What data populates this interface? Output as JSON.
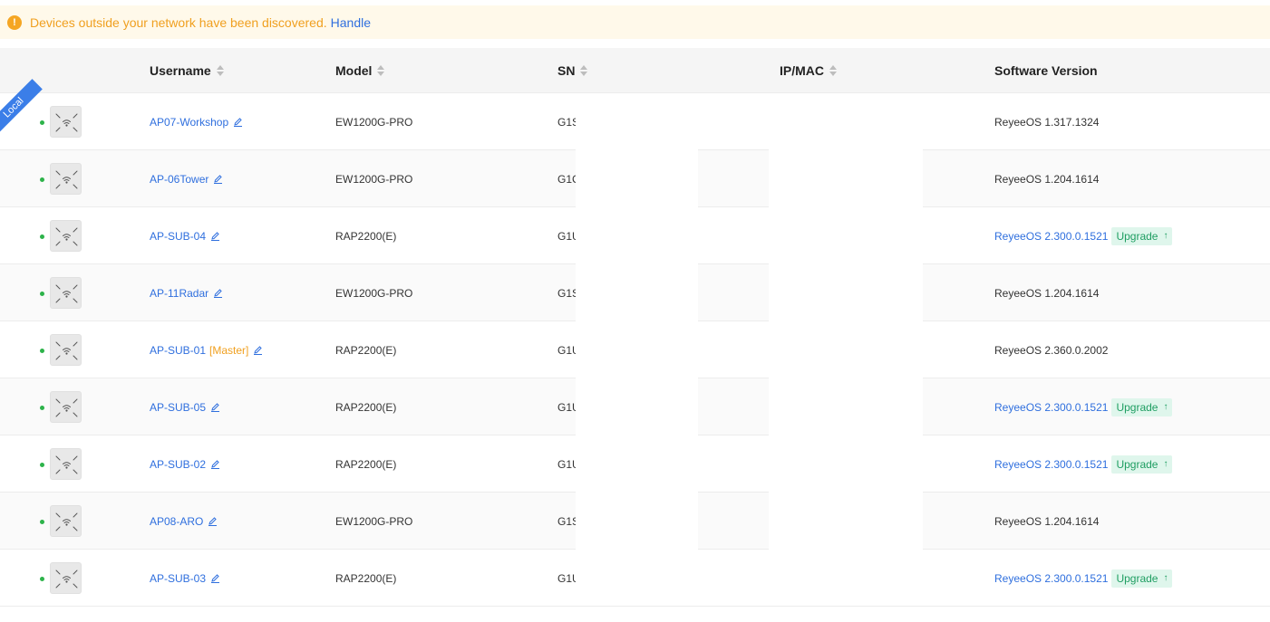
{
  "alert": {
    "icon": "warning-icon",
    "message": "Devices outside your network have been discovered.",
    "link_label": "Handle"
  },
  "columns": {
    "username": "Username",
    "model": "Model",
    "sn": "SN",
    "ipmac": "IP/MAC",
    "version": "Software Version"
  },
  "local_badge": "Local",
  "upgrade_label": "Upgrade",
  "rows": [
    {
      "username": "AP07-Workshop",
      "master": "",
      "model": "EW1200G-PRO",
      "sn": "G1S",
      "version": "ReyeeOS 1.317.1324",
      "upgradable": false
    },
    {
      "username": "AP-06Tower",
      "master": "",
      "model": "EW1200G-PRO",
      "sn": "G1C",
      "version": "ReyeeOS 1.204.1614",
      "upgradable": false
    },
    {
      "username": "AP-SUB-04",
      "master": "",
      "model": "RAP2200(E)",
      "sn": "G1U",
      "version": "ReyeeOS 2.300.0.1521",
      "upgradable": true
    },
    {
      "username": "AP-11Radar",
      "master": "",
      "model": "EW1200G-PRO",
      "sn": "G1S",
      "version": "ReyeeOS 1.204.1614",
      "upgradable": false
    },
    {
      "username": "AP-SUB-01",
      "master": "[Master]",
      "model": "RAP2200(E)",
      "sn": "G1U",
      "version": "ReyeeOS 2.360.0.2002",
      "upgradable": false
    },
    {
      "username": "AP-SUB-05",
      "master": "",
      "model": "RAP2200(E)",
      "sn": "G1U",
      "version": "ReyeeOS 2.300.0.1521",
      "upgradable": true
    },
    {
      "username": "AP-SUB-02",
      "master": "",
      "model": "RAP2200(E)",
      "sn": "G1U",
      "version": "ReyeeOS 2.300.0.1521",
      "upgradable": true
    },
    {
      "username": "AP08-ARO",
      "master": "",
      "model": "EW1200G-PRO",
      "sn": "G1S",
      "version": "ReyeeOS 1.204.1614",
      "upgradable": false
    },
    {
      "username": "AP-SUB-03",
      "master": "",
      "model": "RAP2200(E)",
      "sn": "G1U",
      "version": "ReyeeOS 2.300.0.1521",
      "upgradable": true
    }
  ],
  "colors": {
    "link": "#2f6fde",
    "online": "#2db34a",
    "warning": "#f0a020",
    "upgrade_bg": "#dff6ec",
    "upgrade_text": "#1f9e62"
  }
}
